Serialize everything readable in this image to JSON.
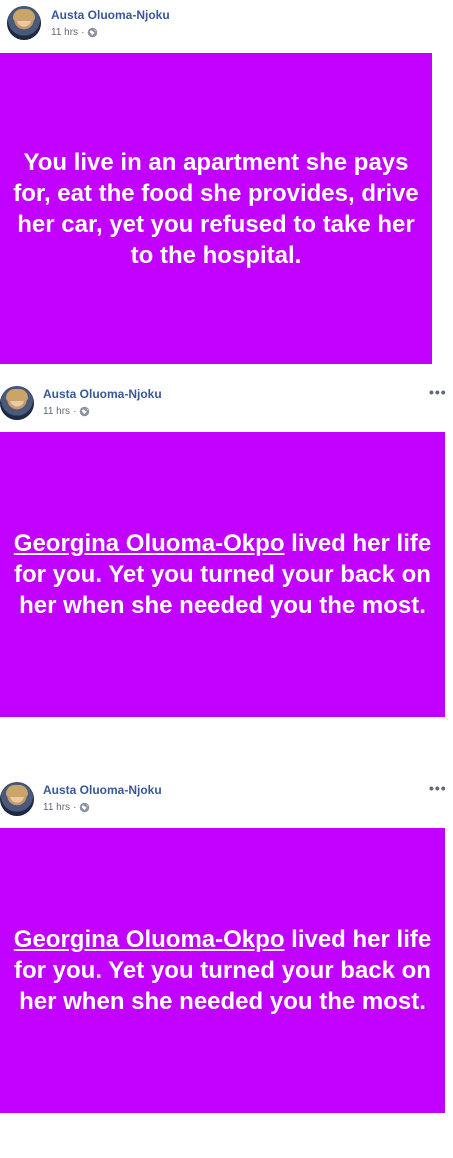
{
  "posts": [
    {
      "author": "Austa Oluoma-Njoku",
      "time": "11 hrs",
      "separator": "·",
      "audience_icon": "globe-icon",
      "has_menu": false,
      "card_color": "#c100ff",
      "mention": "",
      "text": "You live in an apartment she pays for, eat the food she provides, drive her car, yet you refused to take her to the hospital."
    },
    {
      "author": "Austa Oluoma-Njoku",
      "time": "11 hrs",
      "separator": "·",
      "audience_icon": "globe-icon",
      "has_menu": true,
      "menu_label": "•••",
      "card_color": "#c100ff",
      "mention": "Georgina Oluoma-Okpo",
      "text": " lived her life for you. Yet you turned your back on her when she needed you the most."
    },
    {
      "author": "Austa Oluoma-Njoku",
      "time": "11 hrs",
      "separator": "·",
      "audience_icon": "globe-icon",
      "has_menu": true,
      "menu_label": "•••",
      "card_color": "#c100ff",
      "mention": "Georgina Oluoma-Okpo",
      "text": " lived her life for you. Yet you turned your back on her when she needed you the most."
    }
  ]
}
